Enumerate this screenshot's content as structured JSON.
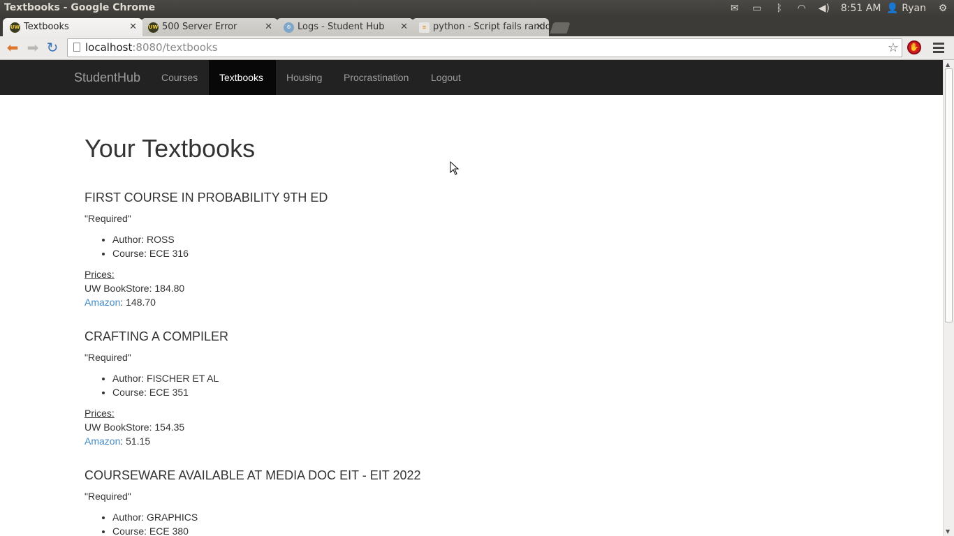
{
  "os": {
    "window_title": "Textbooks - Google Chrome",
    "clock": "8:51 AM",
    "user": "Ryan"
  },
  "tabs": [
    {
      "title": "Textbooks",
      "icon": "uw-favicon"
    },
    {
      "title": "500 Server Error",
      "icon": "uw-favicon"
    },
    {
      "title": "Logs - Student Hub",
      "icon": "logs-favicon"
    },
    {
      "title": "python - Script fails rando",
      "icon": "stackoverflow-favicon"
    }
  ],
  "omnibox": {
    "host": "localhost",
    "rest": ":8080/textbooks"
  },
  "navbar": {
    "brand": "StudentHub",
    "links": [
      "Courses",
      "Textbooks",
      "Housing",
      "Procrastination",
      "Logout"
    ],
    "active": "Textbooks"
  },
  "page": {
    "title": "Your Textbooks",
    "books": [
      {
        "title": "FIRST COURSE IN PROBABILITY 9TH ED",
        "requirement": "\"Required\"",
        "author": "Author: ROSS",
        "course": "Course: ECE 316",
        "prices_label": "Prices:",
        "bookstore": "UW BookStore: 184.80",
        "amazon_link": "Amazon",
        "amazon_price": ": 148.70"
      },
      {
        "title": "CRAFTING A COMPILER",
        "requirement": "\"Required\"",
        "author": "Author: FISCHER ET AL",
        "course": "Course: ECE 351",
        "prices_label": "Prices:",
        "bookstore": "UW BookStore: 154.35",
        "amazon_link": "Amazon",
        "amazon_price": ": 51.15"
      },
      {
        "title": "COURSEWARE AVAILABLE AT MEDIA DOC EIT - EIT 2022",
        "requirement": "\"Required\"",
        "author": "Author: GRAPHICS",
        "course": "Course: ECE 380"
      }
    ]
  },
  "colors": {
    "navbar_bg": "#222222",
    "link": "#428bca",
    "text": "#333333"
  }
}
